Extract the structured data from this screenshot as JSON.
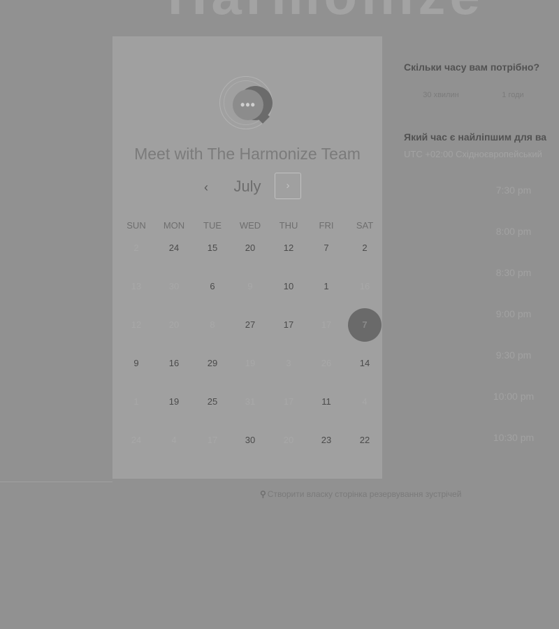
{
  "brand": {
    "text": "Harmonize"
  },
  "card": {
    "avatar_icon": "chat-bubble-icon",
    "avatar_glyph": "•••",
    "title": "Meet with The Harmonize Team",
    "month": "July",
    "prev_glyph": "‹",
    "next_glyph": "›"
  },
  "weekdays": [
    "SUN",
    "MON",
    "TUE",
    "WED",
    "THU",
    "FRI",
    "SAT"
  ],
  "calendar": {
    "rows": [
      [
        {
          "d": "2",
          "a": false
        },
        {
          "d": "24",
          "a": true
        },
        {
          "d": "15",
          "a": true
        },
        {
          "d": "20",
          "a": true
        },
        {
          "d": "12",
          "a": true
        },
        {
          "d": "7",
          "a": true
        },
        {
          "d": "2",
          "a": true
        }
      ],
      [
        {
          "d": "13",
          "a": false
        },
        {
          "d": "30",
          "a": false
        },
        {
          "d": "6",
          "a": true
        },
        {
          "d": "9",
          "a": false
        },
        {
          "d": "10",
          "a": true
        },
        {
          "d": "1",
          "a": true
        },
        {
          "d": "16",
          "a": false
        }
      ],
      [
        {
          "d": "12",
          "a": false
        },
        {
          "d": "20",
          "a": false
        },
        {
          "d": "8",
          "a": false
        },
        {
          "d": "27",
          "a": true
        },
        {
          "d": "17",
          "a": true
        },
        {
          "d": "17",
          "a": false
        },
        {
          "d": "7",
          "a": true,
          "selected": true
        }
      ],
      [
        {
          "d": "9",
          "a": true
        },
        {
          "d": "16",
          "a": true
        },
        {
          "d": "29",
          "a": true
        },
        {
          "d": "19",
          "a": false
        },
        {
          "d": "3",
          "a": false
        },
        {
          "d": "26",
          "a": false
        },
        {
          "d": "14",
          "a": true
        }
      ],
      [
        {
          "d": "1",
          "a": false
        },
        {
          "d": "19",
          "a": true
        },
        {
          "d": "25",
          "a": true
        },
        {
          "d": "31",
          "a": false
        },
        {
          "d": "17",
          "a": false
        },
        {
          "d": "11",
          "a": true
        },
        {
          "d": "4",
          "a": false
        }
      ],
      [
        {
          "d": "24",
          "a": false
        },
        {
          "d": "4",
          "a": false
        },
        {
          "d": "17",
          "a": false
        },
        {
          "d": "30",
          "a": true
        },
        {
          "d": "20",
          "a": false
        },
        {
          "d": "23",
          "a": true
        },
        {
          "d": "22",
          "a": true
        }
      ]
    ]
  },
  "side": {
    "duration_title": "Скільки часу вам потрібно?",
    "durations": [
      "30 хвилин",
      "1 годи"
    ],
    "time_title": "Який час є найліпшим для ва",
    "timezone": "UTC +02:00 Східноєвропейський",
    "slots": [
      "7:30 pm",
      "8:00 pm",
      "8:30 pm",
      "9:00 pm",
      "9:30 pm",
      "10:00 pm",
      "10:30 pm"
    ]
  },
  "footer": {
    "icon": "hubspot-sprocket-icon",
    "glyph": "⚲",
    "text": "Створити власку сторінка резервування зустрічей"
  },
  "colors": {
    "background": "#919191",
    "card": "#a0a0a0",
    "selected_day": "#6a6a6a"
  }
}
